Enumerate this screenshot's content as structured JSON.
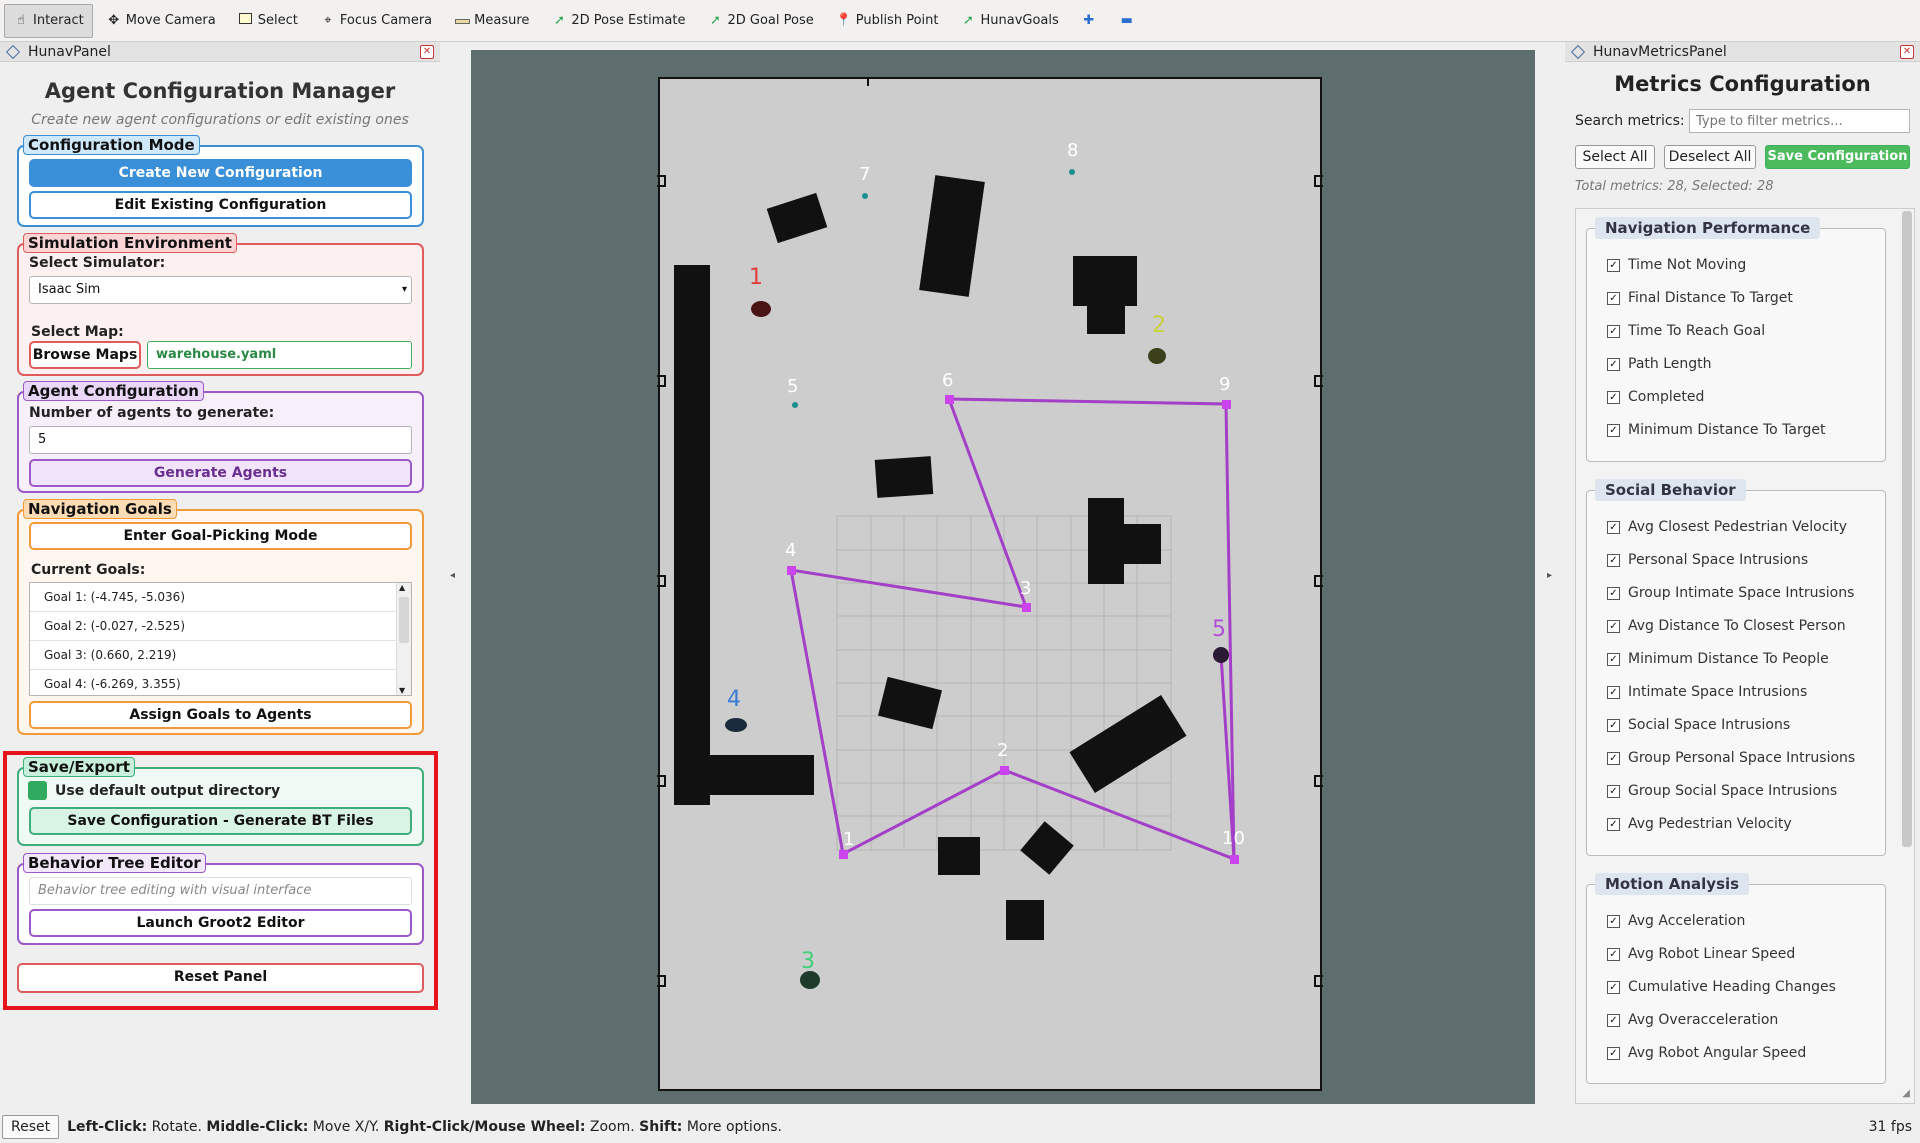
{
  "toolbar": {
    "tools": [
      {
        "label": "Interact",
        "icon": "hand-icon",
        "active": true
      },
      {
        "label": "Move Camera",
        "icon": "move-camera-icon",
        "active": false
      },
      {
        "label": "Select",
        "icon": "select-icon",
        "active": false
      },
      {
        "label": "Focus Camera",
        "icon": "focus-camera-icon",
        "active": false
      },
      {
        "label": "Measure",
        "icon": "ruler-icon",
        "active": false
      },
      {
        "label": "2D Pose Estimate",
        "icon": "green-arrow-icon",
        "active": false
      },
      {
        "label": "2D Goal Pose",
        "icon": "green-arrow-icon",
        "active": false
      },
      {
        "label": "Publish Point",
        "icon": "pin-icon",
        "active": false
      },
      {
        "label": "HunavGoals",
        "icon": "green-arrow-icon",
        "active": false
      }
    ],
    "add_icon": "plus-icon",
    "remove_icon": "minus-icon"
  },
  "left_panel": {
    "title_bar": "HunavPanel",
    "heading": "Agent Configuration Manager",
    "subheading": "Create new agent configurations or edit existing ones",
    "config_mode": {
      "title": "Configuration Mode",
      "create_btn": "Create New Configuration",
      "edit_btn": "Edit Existing Configuration"
    },
    "sim_env": {
      "title": "Simulation Environment",
      "simulator_label": "Select Simulator:",
      "simulator_value": "Isaac Sim",
      "map_label": "Select Map:",
      "browse_btn": "Browse Maps",
      "map_value": "warehouse.yaml"
    },
    "agent_config": {
      "title": "Agent Configuration",
      "count_label": "Number of agents to generate:",
      "count_value": "5",
      "generate_btn": "Generate Agents"
    },
    "nav_goals": {
      "title": "Navigation Goals",
      "picking_btn": "Enter Goal-Picking Mode",
      "current_label": "Current Goals:",
      "goals": [
        "Goal 1: (-4.745, -5.036)",
        "Goal 2: (-0.027, -2.525)",
        "Goal 3: (0.660, 2.219)",
        "Goal 4: (-6.269, 3.355)"
      ],
      "assign_btn": "Assign Goals to Agents"
    },
    "save_export": {
      "title": "Save/Export",
      "default_dir_label": "Use default output directory",
      "save_btn": "Save Configuration - Generate BT Files"
    },
    "bt_editor": {
      "title": "Behavior Tree Editor",
      "placeholder": "Behavior tree editing with visual interface",
      "launch_btn": "Launch Groot2 Editor"
    },
    "reset_btn": "Reset Panel",
    "colors": {
      "highlight": "#e8141b"
    }
  },
  "map": {
    "waypoints": [
      "1",
      "2",
      "3",
      "4",
      "5",
      "6",
      "7",
      "8",
      "9",
      "10"
    ],
    "agents": [
      {
        "label": "1",
        "color": "#e23b3b"
      },
      {
        "label": "2",
        "color": "#c8d23a"
      },
      {
        "label": "3",
        "color": "#3ecf7a"
      },
      {
        "label": "4",
        "color": "#3a7bd8"
      },
      {
        "label": "5",
        "color": "#b14fd8"
      }
    ],
    "path_color": "#a43fc8"
  },
  "right_panel": {
    "title_bar": "HunavMetricsPanel",
    "heading": "Metrics Configuration",
    "search_label": "Search metrics:",
    "search_placeholder": "Type to filter metrics...",
    "select_all": "Select All",
    "deselect_all": "Deselect All",
    "save_btn": "Save Configuration",
    "totals": "Total metrics: 28, Selected: 28",
    "groups": [
      {
        "title": "Navigation Performance",
        "items": [
          "Time Not Moving",
          "Final Distance To Target",
          "Time To Reach Goal",
          "Path Length",
          "Completed",
          "Minimum Distance To Target"
        ]
      },
      {
        "title": "Social Behavior",
        "items": [
          "Avg Closest Pedestrian Velocity",
          "Personal Space Intrusions",
          "Group Intimate Space Intrusions",
          "Avg Distance To Closest Person",
          "Minimum Distance To People",
          "Intimate Space Intrusions",
          "Social Space Intrusions",
          "Group Personal Space Intrusions",
          "Group Social Space Intrusions",
          "Avg Pedestrian Velocity"
        ]
      },
      {
        "title": "Motion Analysis",
        "items": [
          "Avg Acceleration",
          "Avg Robot Linear Speed",
          "Cumulative Heading Changes",
          "Avg Overacceleration",
          "Avg Robot Angular Speed"
        ]
      }
    ]
  },
  "status_bar": {
    "reset": "Reset",
    "k1": "Left-Click:",
    "v1": " Rotate. ",
    "k2": "Middle-Click:",
    "v2": " Move X/Y. ",
    "k3": "Right-Click/Mouse Wheel:",
    "v3": " Zoom. ",
    "k4": "Shift:",
    "v4": " More options.",
    "fps": "31 fps"
  }
}
